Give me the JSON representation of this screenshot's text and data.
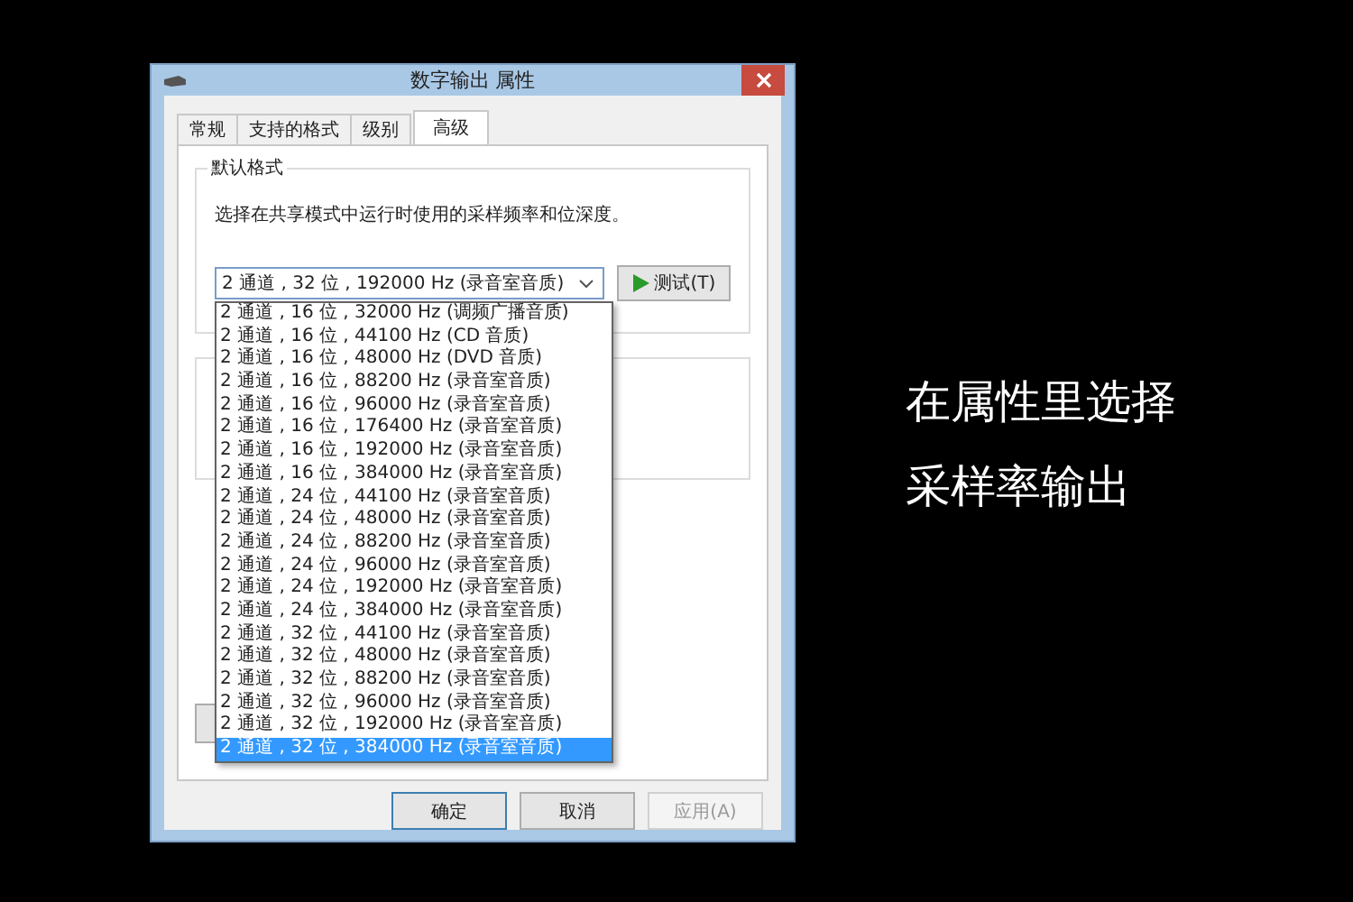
{
  "window": {
    "title": "数字输出 属性"
  },
  "tabs": [
    {
      "label": "常规",
      "selected": false
    },
    {
      "label": "支持的格式",
      "selected": false
    },
    {
      "label": "级别",
      "selected": false
    },
    {
      "label": "高级",
      "selected": true
    }
  ],
  "default_format": {
    "title": "默认格式",
    "description": "选择在共享模式中运行时使用的采样频率和位深度。",
    "combo_value": "2 通道 , 32 位 , 192000 Hz (录音室音质)",
    "test_button": "测试(T)"
  },
  "dropdown": {
    "items": [
      {
        "label": "2 通道 , 16 位 , 32000 Hz (调频广播音质)",
        "selected": false
      },
      {
        "label": "2 通道 , 16 位 , 44100 Hz (CD 音质)",
        "selected": false
      },
      {
        "label": "2 通道 , 16 位 , 48000 Hz (DVD 音质)",
        "selected": false
      },
      {
        "label": "2 通道 , 16 位 , 88200 Hz (录音室音质)",
        "selected": false
      },
      {
        "label": "2 通道 , 16 位 , 96000 Hz (录音室音质)",
        "selected": false
      },
      {
        "label": "2 通道 , 16 位 , 176400 Hz (录音室音质)",
        "selected": false
      },
      {
        "label": "2 通道 , 16 位 , 192000 Hz (录音室音质)",
        "selected": false
      },
      {
        "label": "2 通道 , 16 位 , 384000 Hz (录音室音质)",
        "selected": false
      },
      {
        "label": "2 通道 , 24 位 , 44100 Hz (录音室音质)",
        "selected": false
      },
      {
        "label": "2 通道 , 24 位 , 48000 Hz (录音室音质)",
        "selected": false
      },
      {
        "label": "2 通道 , 24 位 , 88200 Hz (录音室音质)",
        "selected": false
      },
      {
        "label": "2 通道 , 24 位 , 96000 Hz (录音室音质)",
        "selected": false
      },
      {
        "label": "2 通道 , 24 位 , 192000 Hz (录音室音质)",
        "selected": false
      },
      {
        "label": "2 通道 , 24 位 , 384000 Hz (录音室音质)",
        "selected": false
      },
      {
        "label": "2 通道 , 32 位 , 44100 Hz (录音室音质)",
        "selected": false
      },
      {
        "label": "2 通道 , 32 位 , 48000 Hz (录音室音质)",
        "selected": false
      },
      {
        "label": "2 通道 , 32 位 , 88200 Hz (录音室音质)",
        "selected": false
      },
      {
        "label": "2 通道 , 32 位 , 96000 Hz (录音室音质)",
        "selected": false
      },
      {
        "label": "2 通道 , 32 位 , 192000 Hz (录音室音质)",
        "selected": false
      },
      {
        "label": "2 通道 , 32 位 , 384000 Hz (录音室音质)",
        "selected": true
      }
    ]
  },
  "buttons": [
    {
      "label": "确定",
      "default": true,
      "disabled": false
    },
    {
      "label": "取消",
      "default": false,
      "disabled": false
    },
    {
      "label": "应用(A)",
      "default": false,
      "disabled": true
    }
  ],
  "caption": [
    "在属性里选择",
    "采样率输出"
  ]
}
